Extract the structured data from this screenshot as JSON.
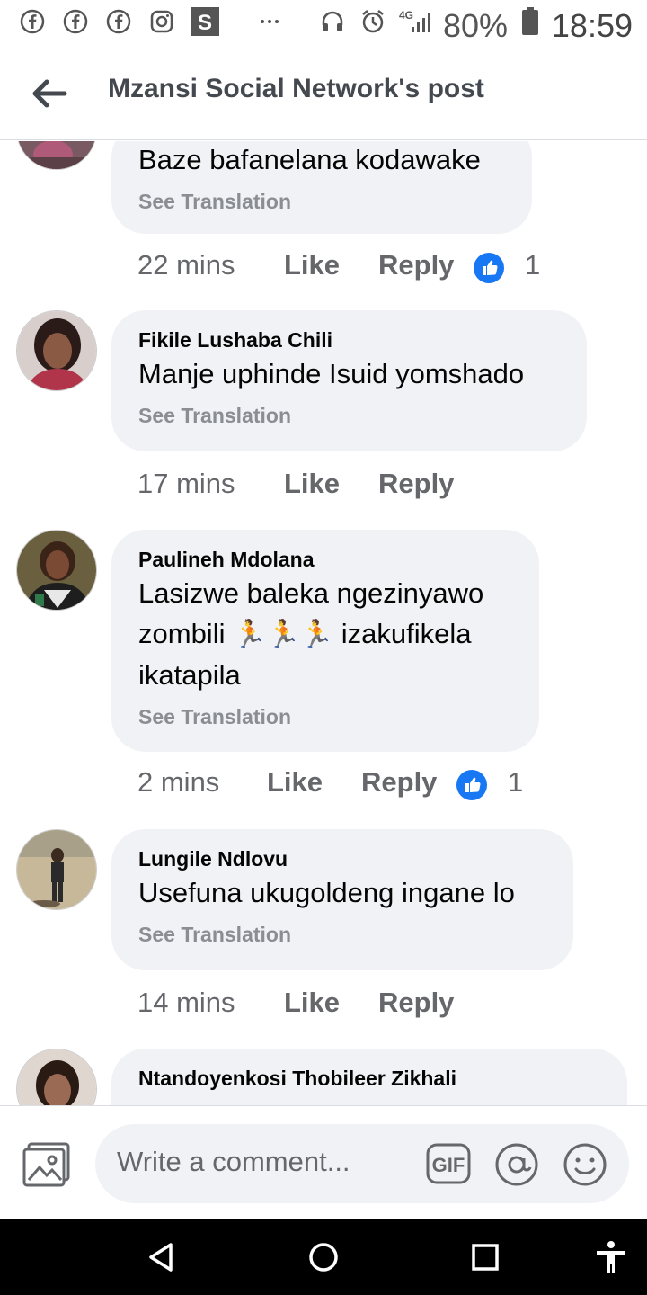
{
  "status_bar": {
    "network": "4G",
    "battery": "80%",
    "time": "18:59",
    "icons": [
      "facebook-icon",
      "facebook-icon",
      "facebook-icon",
      "instagram-icon",
      "s-app-icon",
      "more-icon",
      "headset-icon",
      "alarm-icon",
      "signal-icon",
      "battery-icon"
    ]
  },
  "header": {
    "title": "Mzansi Social Network's post"
  },
  "comments": [
    {
      "text": "Baze bafanelana kodawake",
      "see_translation": "See Translation",
      "time": "22 mins",
      "like": "Like",
      "reply": "Reply",
      "reactions": "1"
    },
    {
      "author": "Fikile Lushaba Chili",
      "text": "Manje uphinde Isuid yomshado",
      "see_translation": "See Translation",
      "time": "17 mins",
      "like": "Like",
      "reply": "Reply"
    },
    {
      "author": "Paulineh Mdolana",
      "text_line1": "Lasizwe baleka ngezinyawo",
      "text_line2_a": "zombili",
      "emoji": "🏃🏃🏃",
      "text_line2_b": "izakufikela",
      "text_line3": "ikatapila",
      "see_translation": "See Translation",
      "time": "2 mins",
      "like": "Like",
      "reply": "Reply",
      "reactions": "1"
    },
    {
      "author": "Lungile Ndlovu",
      "text": "Usefuna ukugoldeng ingane lo",
      "see_translation": "See Translation",
      "time": "14 mins",
      "like": "Like",
      "reply": "Reply"
    },
    {
      "author": "Ntandoyenkosi Thobileer Zikhali"
    }
  ],
  "composer": {
    "placeholder": "Write a comment...",
    "gif_label": "GIF"
  },
  "colors": {
    "like_blue": "#1877f2",
    "bubble_bg": "#f0f2f5",
    "meta_gray": "#65676b"
  }
}
